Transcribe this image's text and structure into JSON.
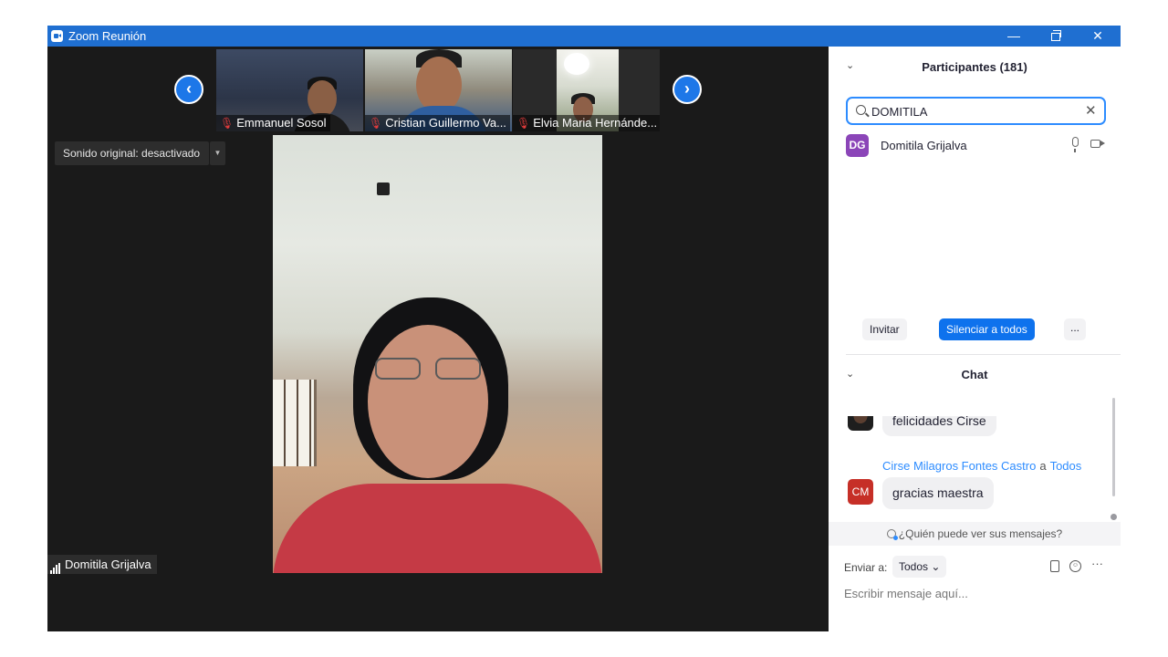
{
  "window": {
    "title": "Zoom Reunión",
    "minimize_glyph": "—",
    "close_glyph": "✕"
  },
  "gallery": {
    "prev_glyph": "‹",
    "next_glyph": "›",
    "thumbnails": [
      {
        "name": "Emmanuel Sosol",
        "muted": true
      },
      {
        "name": "Cristian Guillermo Va...",
        "muted": true
      },
      {
        "name": "Elvia Maria Hernánde...",
        "muted": true
      }
    ]
  },
  "sound_toggle": {
    "label": "Sonido original: desactivado",
    "caret_glyph": "▼"
  },
  "active_speaker": {
    "name": "Domitila Grijalva"
  },
  "participants": {
    "collapse_glyph": "⌄",
    "title": "Participantes (181)",
    "search_value": "DOMITILA",
    "clear_glyph": "✕",
    "list": [
      {
        "initials": "DG",
        "name": "Domitila Grijalva",
        "avatar_color": "#8b45b8"
      }
    ],
    "invite_label": "Invitar",
    "mute_all_label": "Silenciar a todos",
    "more_label": "..."
  },
  "chat": {
    "collapse_glyph": "⌄",
    "title": "Chat",
    "messages": [
      {
        "text": "felicidades Cirse"
      },
      {
        "sender": "Cirse Milagros Fontes Castro",
        "to_word": "a",
        "recipient": "Todos",
        "initials": "CM",
        "avatar_color": "#c62f27",
        "text": "gracias maestra"
      }
    ],
    "who_can_see": "¿Quién puede ver sus mensajes?",
    "send_to_label": "Enviar a:",
    "send_to_value": "Todos ⌄",
    "emoji_glyph": "☺",
    "more_glyph": "···",
    "input_placeholder": "Escribir mensaje aquí..."
  },
  "colors": {
    "title_bar": "#1f6fd1",
    "accent": "#2d8cff",
    "primary_button": "#0e72ed",
    "muted_mic": "#e23b3b",
    "video_background": "#1a1a1a"
  }
}
